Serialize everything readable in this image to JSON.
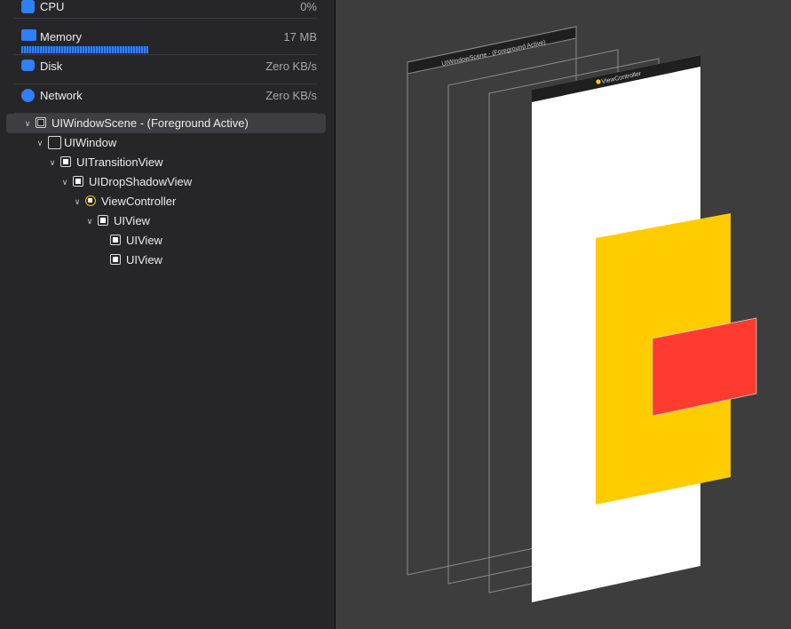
{
  "gauges": {
    "cpu": {
      "label": "CPU",
      "value": "0%",
      "icon": "cpu-icon"
    },
    "memory": {
      "label": "Memory",
      "value": "17 MB",
      "icon": "memory-icon"
    },
    "disk": {
      "label": "Disk",
      "value": "Zero KB/s",
      "icon": "disk-icon"
    },
    "network": {
      "label": "Network",
      "value": "Zero KB/s",
      "icon": "network-icon"
    }
  },
  "hierarchy": [
    {
      "label": "UIWindowScene - (Foreground Active)",
      "depth": 0,
      "icon": "scene-icon",
      "expanded": true,
      "selected": true
    },
    {
      "label": "UIWindow",
      "depth": 1,
      "icon": "window-icon",
      "expanded": true
    },
    {
      "label": "UITransitionView",
      "depth": 2,
      "icon": "view-icon",
      "expanded": true
    },
    {
      "label": "UIDropShadowView",
      "depth": 3,
      "icon": "view-icon",
      "expanded": true
    },
    {
      "label": "ViewController",
      "depth": 4,
      "icon": "view-controller-icon",
      "expanded": true
    },
    {
      "label": "UIView",
      "depth": 5,
      "icon": "view-icon",
      "expanded": true
    },
    {
      "label": "UIView",
      "depth": 6,
      "icon": "view-icon"
    },
    {
      "label": "UIView",
      "depth": 6,
      "icon": "view-icon"
    }
  ],
  "canvas": {
    "scene_label": "UIWindowScene - (Foreground Active)",
    "view_controller_label": "ViewController",
    "colors": {
      "background": "#3d3d3d",
      "root_view": "#ffffff",
      "yellow_view": "#ffcc00",
      "red_view": "#ff3b30",
      "wireframe": "#8a8a8a"
    }
  }
}
